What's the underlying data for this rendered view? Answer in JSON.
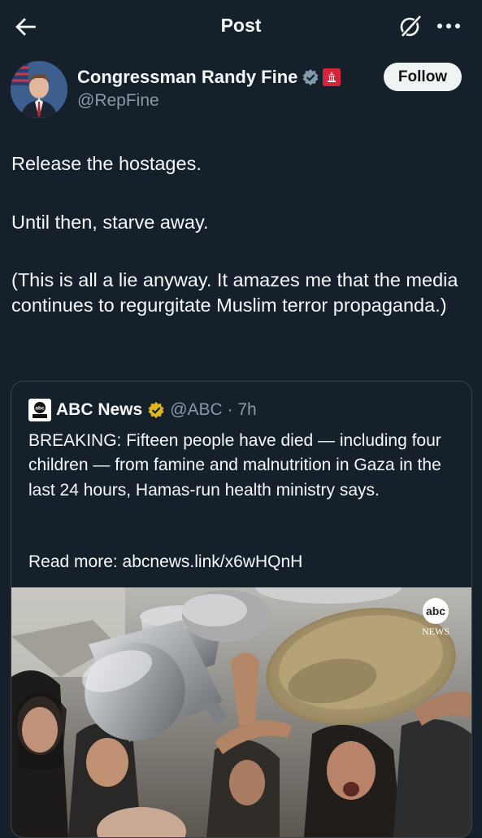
{
  "header": {
    "title": "Post",
    "icons": [
      "back-arrow-icon",
      "grok-icon",
      "more-options-icon"
    ]
  },
  "author": {
    "name": "Congressman Randy Fine",
    "handle": "@RepFine",
    "follow_label": "Follow"
  },
  "post": {
    "paragraphs": [
      "Release the hostages.",
      "Until then, starve away.",
      "(This is all a lie anyway.  It amazes me that the media continues to regurgitate Muslim terror propaganda.)"
    ]
  },
  "quoted_post": {
    "name": "ABC News",
    "meta": "@ABC · 7h",
    "text": "BREAKING: Fifteen people have died — including four children — from famine and malnutrition in Gaza in the last 24 hours, Hamas-run health ministry says.",
    "link_line": "Read more: abcnews.link/x6wHQnH",
    "image_watermark": "NEWS"
  },
  "colors": {
    "background": "#15202b",
    "text": "#f7f9f9",
    "secondary": "#8b98a5",
    "verified_blue": "#829aab",
    "verified_gold": "#e2b719",
    "border": "#38444d"
  }
}
